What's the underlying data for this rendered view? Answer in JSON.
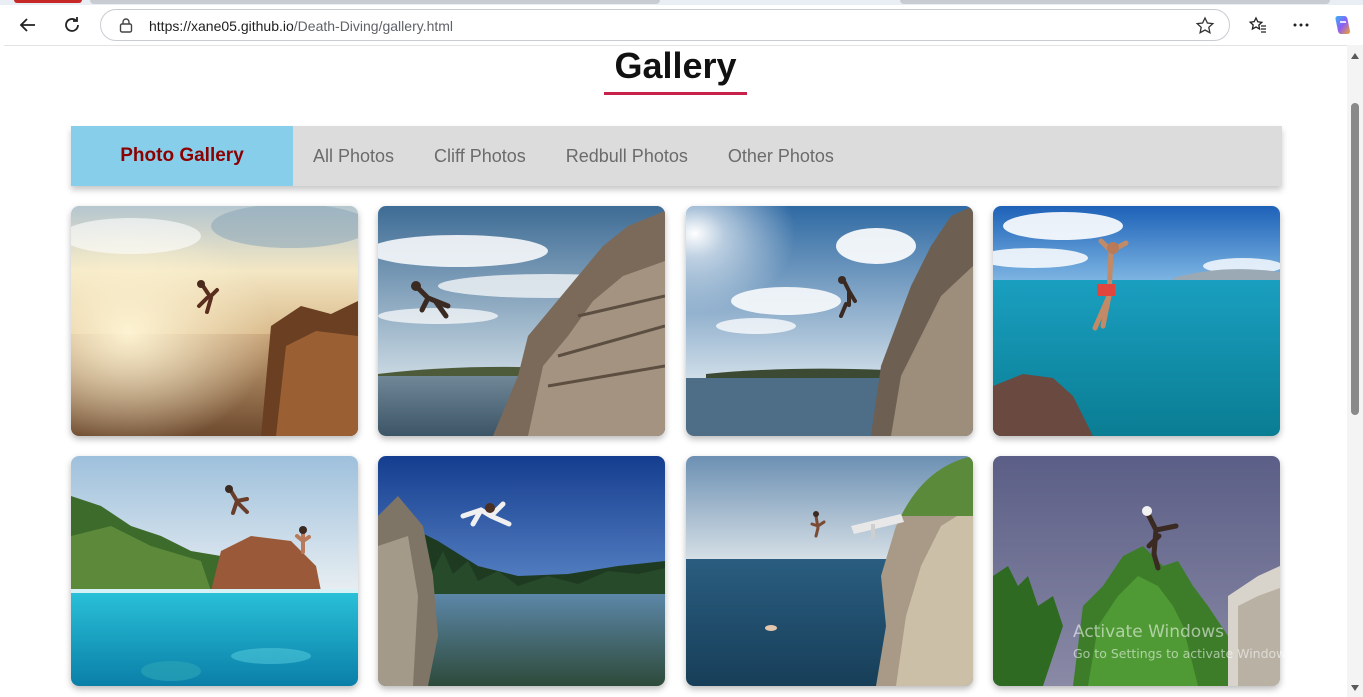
{
  "browser": {
    "url_host": "https://xane05.github.io",
    "url_path": "/Death-Diving/gallery.html",
    "icons": [
      "back-arrow-icon",
      "refresh-icon",
      "lock-icon",
      "star-icon",
      "favorites-icon",
      "more-icon",
      "copilot-icon"
    ]
  },
  "page": {
    "title": "Gallery",
    "accent_color": "#c8224a"
  },
  "nav": {
    "brand": "Photo Gallery",
    "links": [
      "All Photos",
      "Cliff Photos",
      "Redbull Photos",
      "Other Photos"
    ],
    "brand_bg": "#87ceeb",
    "brand_color": "#8b0000"
  },
  "gallery": {
    "photos": [
      {
        "name": "photo-sunset-cliff-dive"
      },
      {
        "name": "photo-rocky-cliff-jump"
      },
      {
        "name": "photo-sunny-cliff-jump"
      },
      {
        "name": "photo-turquoise-sea-dive"
      },
      {
        "name": "photo-underwater-split-view"
      },
      {
        "name": "photo-lake-forest-jump"
      },
      {
        "name": "photo-platform-sea-dive"
      },
      {
        "name": "photo-tree-tops-jump"
      }
    ]
  },
  "os": {
    "watermark_title": "Activate Windows",
    "watermark_subtitle": "Go to Settings to activate Windows."
  }
}
